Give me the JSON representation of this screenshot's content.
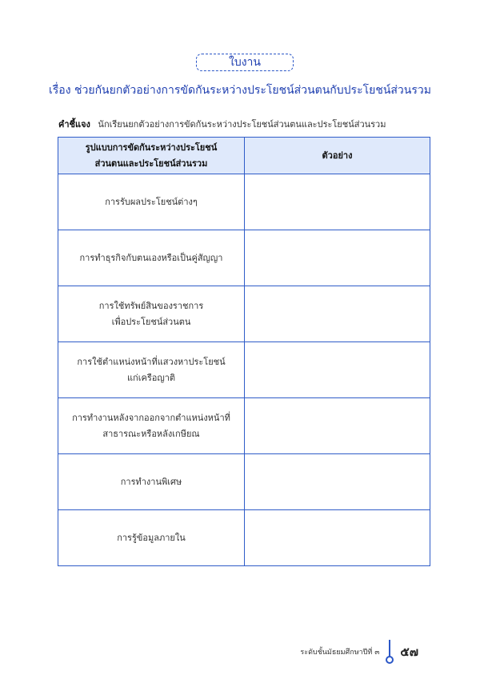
{
  "badge": {
    "text": "ใบงาน"
  },
  "title": "เรื่อง ช่วยกันยกตัวอย่างการขัดกันระหว่างประโยชน์ส่วนตนกับประโยชน์ส่วนรวม",
  "instruction": {
    "label": "คำชี้แจง",
    "text": "นักเรียนยกตัวอย่างการขัดกันระหว่างประโยชน์ส่วนตนและประโยชน์ส่วนรวม"
  },
  "table": {
    "headers": {
      "pattern": "รูปแบบการขัดกันระหว่างประโยชน์\nส่วนตนและประโยชน์ส่วนรวม",
      "example": "ตัวอย่าง"
    },
    "rows": [
      {
        "pattern": "การรับผลประโยชน์ต่างๆ",
        "example": ""
      },
      {
        "pattern": "การทำธุรกิจกับตนเองหรือเป็นคู่สัญญา",
        "example": ""
      },
      {
        "pattern": "การใช้ทรัพย์สินของราชการ\nเพื่อประโยชน์ส่วนตน",
        "example": ""
      },
      {
        "pattern": "การใช้ตำแหน่งหน้าที่แสวงหาประโยชน์\nแก่เครือญาติ",
        "example": ""
      },
      {
        "pattern": "การทำงานหลังจากออกจากตำแหน่งหน้าที่\nสาธารณะหรือหลังเกษียณ",
        "example": ""
      },
      {
        "pattern": "การทำงานพิเศษ",
        "example": ""
      },
      {
        "pattern": "การรู้ข้อมูลภายใน",
        "example": ""
      }
    ]
  },
  "footer": {
    "text": "ระดับชั้นมัธยมศึกษาปีที่ ๓",
    "page_number": "๕๗"
  }
}
